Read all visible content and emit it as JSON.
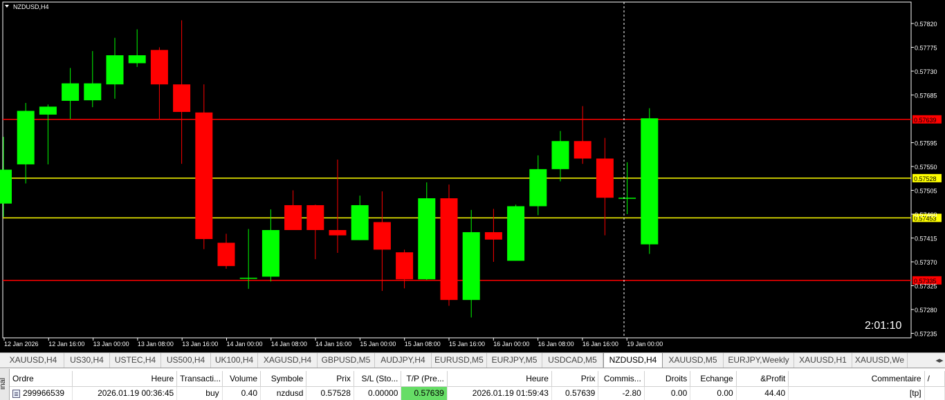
{
  "chart": {
    "symbol_label": "NZDUSD,H4",
    "countdown": "2:01:10",
    "price_labels": [
      "0.57820",
      "0.57775",
      "0.57730",
      "0.57685",
      "0.57595",
      "0.57550",
      "0.57505",
      "0.57460",
      "0.57415",
      "0.57370",
      "0.57325",
      "0.57280",
      "0.57235"
    ],
    "hlines": [
      {
        "price": 0.57639,
        "color": "#ff0000",
        "label": "0.57639"
      },
      {
        "price": 0.57528,
        "color": "#ffff00",
        "label": "0.57528"
      },
      {
        "price": 0.57453,
        "color": "#ffff00",
        "label": "0.57453"
      },
      {
        "price": 0.57335,
        "color": "#ff0000",
        "label": "0.57335"
      }
    ],
    "time_labels": [
      "12 Jan 2026",
      "12 Jan 16:00",
      "13 Jan 00:00",
      "13 Jan 08:00",
      "13 Jan 16:00",
      "14 Jan 00:00",
      "14 Jan 08:00",
      "14 Jan 16:00",
      "15 Jan 00:00",
      "15 Jan 08:00",
      "15 Jan 16:00",
      "16 Jan 00:00",
      "16 Jan 08:00",
      "16 Jan 16:00",
      "19 Jan 00:00"
    ],
    "up_color": "#00ff00",
    "down_color": "#ff0000"
  },
  "chart_data": {
    "type": "candlestick",
    "symbol": "NZDUSD",
    "timeframe": "H4",
    "y_range": [
      0.5723,
      0.5784
    ],
    "candles": [
      {
        "o": 0.5748,
        "h": 0.57606,
        "l": 0.57455,
        "c": 0.57544
      },
      {
        "o": 0.57554,
        "h": 0.5767,
        "l": 0.57518,
        "c": 0.57655
      },
      {
        "o": 0.57648,
        "h": 0.57667,
        "l": 0.57554,
        "c": 0.57663
      },
      {
        "o": 0.57674,
        "h": 0.57736,
        "l": 0.5764,
        "c": 0.57707
      },
      {
        "o": 0.57675,
        "h": 0.57768,
        "l": 0.57662,
        "c": 0.57707
      },
      {
        "o": 0.57705,
        "h": 0.57793,
        "l": 0.57678,
        "c": 0.5776
      },
      {
        "o": 0.57745,
        "h": 0.57809,
        "l": 0.57738,
        "c": 0.5776
      },
      {
        "o": 0.5777,
        "h": 0.57775,
        "l": 0.5764,
        "c": 0.57705
      },
      {
        "o": 0.57705,
        "h": 0.57826,
        "l": 0.57555,
        "c": 0.57653
      },
      {
        "o": 0.57652,
        "h": 0.57705,
        "l": 0.57394,
        "c": 0.57413
      },
      {
        "o": 0.57406,
        "h": 0.57423,
        "l": 0.57357,
        "c": 0.57362
      },
      {
        "o": 0.5734,
        "h": 0.57432,
        "l": 0.57319,
        "c": 0.5734
      },
      {
        "o": 0.57342,
        "h": 0.57469,
        "l": 0.57333,
        "c": 0.5743
      },
      {
        "o": 0.57477,
        "h": 0.57505,
        "l": 0.5743,
        "c": 0.5743
      },
      {
        "o": 0.57477,
        "h": 0.57478,
        "l": 0.57375,
        "c": 0.5743
      },
      {
        "o": 0.5743,
        "h": 0.57563,
        "l": 0.57387,
        "c": 0.5742
      },
      {
        "o": 0.57411,
        "h": 0.57495,
        "l": 0.57411,
        "c": 0.57477
      },
      {
        "o": 0.57445,
        "h": 0.57503,
        "l": 0.57315,
        "c": 0.57393
      },
      {
        "o": 0.57388,
        "h": 0.57393,
        "l": 0.5732,
        "c": 0.57337
      },
      {
        "o": 0.57337,
        "h": 0.5752,
        "l": 0.57336,
        "c": 0.5749
      },
      {
        "o": 0.5749,
        "h": 0.57516,
        "l": 0.57287,
        "c": 0.57298
      },
      {
        "o": 0.57298,
        "h": 0.57468,
        "l": 0.57265,
        "c": 0.57426
      },
      {
        "o": 0.57426,
        "h": 0.5747,
        "l": 0.5737,
        "c": 0.57412
      },
      {
        "o": 0.57372,
        "h": 0.57478,
        "l": 0.57372,
        "c": 0.57475
      },
      {
        "o": 0.57475,
        "h": 0.57571,
        "l": 0.57458,
        "c": 0.57545
      },
      {
        "o": 0.57545,
        "h": 0.57617,
        "l": 0.57522,
        "c": 0.57598
      },
      {
        "o": 0.57598,
        "h": 0.57664,
        "l": 0.57555,
        "c": 0.57565
      },
      {
        "o": 0.57565,
        "h": 0.57604,
        "l": 0.5742,
        "c": 0.57491
      },
      {
        "o": 0.57491,
        "h": 0.57558,
        "l": 0.5746,
        "c": 0.57491
      },
      {
        "o": 0.57403,
        "h": 0.5766,
        "l": 0.57385,
        "c": 0.57641
      }
    ]
  },
  "tabs": [
    "XAUUSD,H4",
    "US30,H4",
    "USTEC,H4",
    "US500,H4",
    "UK100,H4",
    "XAGUSD,H4",
    "GBPUSD,M5",
    "AUDJPY,H4",
    "EURUSD,M5",
    "EURJPY,M5",
    "USDCAD,M5",
    "NZDUSD,H4",
    "XAUUSD,M5",
    "EURJPY,Weekly",
    "XAUUSD,H1",
    "XAUUSD,We"
  ],
  "active_tab": "NZDUSD,H4",
  "terminal": {
    "side_label": "inal",
    "headers": [
      "Ordre",
      "Heure",
      "Transacti...",
      "Volume",
      "Symbole",
      "Prix",
      "S/L (Sto...",
      "T/P (Pre...",
      "Heure",
      "Prix",
      "Commis...",
      "Droits",
      "Echange",
      "&Profit",
      "Commentaire",
      "/"
    ],
    "row": {
      "order": "299966539",
      "open_time": "2026.01.19 00:36:45",
      "type": "buy",
      "volume": "0.40",
      "symbol": "nzdusd",
      "open_price": "0.57528",
      "sl": "0.00000",
      "tp": "0.57639",
      "time": "2026.01.19 01:59:43",
      "price": "0.57639",
      "commission": "-2.80",
      "swap_rights": "0.00",
      "exchange": "0.00",
      "profit": "44.40",
      "comment": "[tp]"
    }
  }
}
